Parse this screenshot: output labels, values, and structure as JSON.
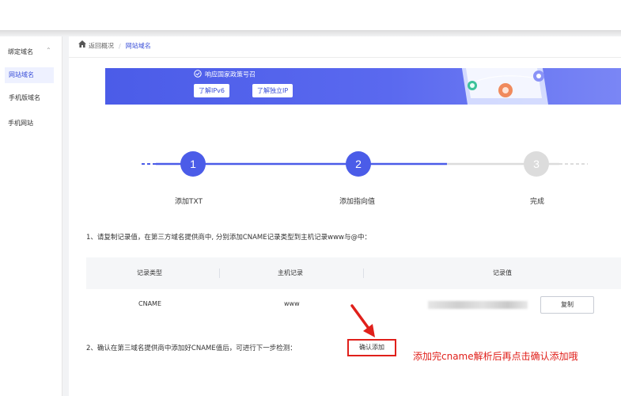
{
  "sidebar": {
    "group_label": "绑定域名",
    "items": [
      {
        "label": "网站域名"
      },
      {
        "label": "手机版域名"
      }
    ],
    "mobile_site_label": "手机网站"
  },
  "breadcrumb": {
    "back_label": "返回概况",
    "current_label": "网站域名"
  },
  "banner": {
    "policy_text": "响应国家政策号召",
    "ipv6_button": "了解IPv6",
    "ip_button": "了解独立IP"
  },
  "steps": {
    "items": [
      {
        "number": "1",
        "label": "添加TXT",
        "state": "done"
      },
      {
        "number": "2",
        "label": "添加指向值",
        "state": "active"
      },
      {
        "number": "3",
        "label": "完成",
        "state": "pending"
      }
    ],
    "active_color": "#4b5ce8",
    "pending_color": "#dcdcdc"
  },
  "instructions": {
    "step1_text": "1、请复制记录值，在第三方域名提供商中, 分别添加CNAME记录类型到主机记录www与@中：",
    "step2_text": "2、确认在第三域名提供商中添加好CNAME值后，可进行下一步检测：",
    "confirm_button": "确认添加"
  },
  "record_table": {
    "headers": [
      "记录类型",
      "主机记录",
      "记录值"
    ],
    "rows": [
      {
        "type": "CNAME",
        "host": "www",
        "copy_button": "复制"
      }
    ]
  },
  "annotation": {
    "text": "添加完cname解析后再点击确认添加哦",
    "color": "#e0201b"
  }
}
